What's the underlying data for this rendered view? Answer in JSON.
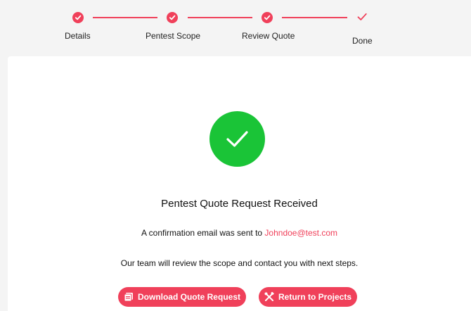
{
  "stepper": {
    "steps": [
      {
        "label": "Details",
        "status": "complete"
      },
      {
        "label": "Pentest Scope",
        "status": "complete"
      },
      {
        "label": "Review Quote",
        "status": "complete"
      },
      {
        "label": "Done",
        "status": "current"
      }
    ]
  },
  "confirmation": {
    "title": "Pentest Quote Request Received",
    "email_prefix": "A confirmation email was sent to ",
    "email": "Johndoe@test.com",
    "next_steps": "Our team will review the scope and contact you with next steps."
  },
  "actions": {
    "download_label": "Download Quote Request",
    "return_label": "Return to Projects"
  },
  "colors": {
    "accent": "#f0405a",
    "success": "#1ac437",
    "page_background": "#f4f4f4",
    "card_background": "#ffffff"
  },
  "icons": {
    "step_complete": "check-circle-icon",
    "step_done": "check-icon",
    "success": "check-icon",
    "download": "pdf-icon",
    "return": "tools-icon"
  }
}
